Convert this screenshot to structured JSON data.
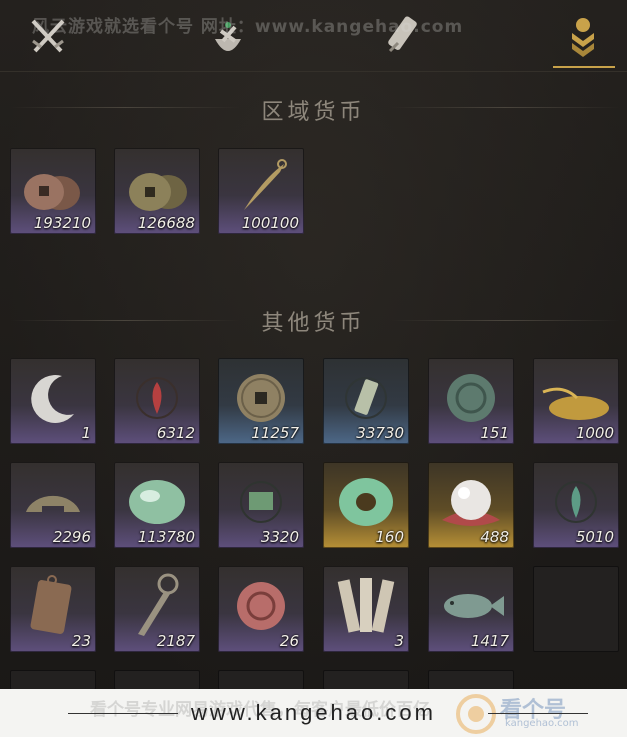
{
  "watermark_top": "风云游戏就选看个号  网址：www.kangehao.com",
  "tabs": [
    {
      "name": "crossed-swords-icon"
    },
    {
      "name": "pouch-icon"
    },
    {
      "name": "scroll-icon"
    },
    {
      "name": "currency-chevron-icon",
      "active": true
    }
  ],
  "colors": {
    "accent": "#c8a24a",
    "purple_tile": "#5e4f7c",
    "blue_tile": "#4d6888",
    "gold_tile": "#b79036"
  },
  "sections": {
    "regional": {
      "title": "区域货币"
    },
    "other": {
      "title": "其他货币"
    }
  },
  "regional_items": [
    {
      "icon": "copper-coin-stack-icon",
      "count": "193210"
    },
    {
      "icon": "bronze-coin-stack-icon",
      "count": "126688"
    },
    {
      "icon": "feather-token-icon",
      "count": "100100"
    }
  ],
  "other_items": [
    {
      "icon": "crescent-moon-icon",
      "count": "1"
    },
    {
      "icon": "red-flame-emblem-icon",
      "count": "6312"
    },
    {
      "icon": "bronze-coin-icon",
      "count": "11257",
      "tier": "blue"
    },
    {
      "icon": "jade-tag-icon",
      "count": "33730",
      "tier": "blue"
    },
    {
      "icon": "jade-medallion-icon",
      "count": "151"
    },
    {
      "icon": "grain-pile-icon",
      "count": "1000"
    },
    {
      "icon": "broken-coin-icon",
      "count": "2296"
    },
    {
      "icon": "jade-stone-icon",
      "count": "113780"
    },
    {
      "icon": "map-fragment-icon",
      "count": "3320"
    },
    {
      "icon": "jade-ring-icon",
      "count": "160",
      "tier": "gold"
    },
    {
      "icon": "pearl-icon",
      "count": "488",
      "tier": "gold"
    },
    {
      "icon": "green-flame-emblem-icon",
      "count": "5010"
    },
    {
      "icon": "bronze-plaque-icon",
      "count": "23"
    },
    {
      "icon": "coin-sword-icon",
      "count": "2187"
    },
    {
      "icon": "red-medallion-icon",
      "count": "26"
    },
    {
      "icon": "bamboo-slips-icon",
      "count": "3"
    },
    {
      "icon": "jade-fish-icon",
      "count": "1417"
    },
    {
      "icon": "empty-slot",
      "count": ""
    }
  ],
  "bottom_bar": {
    "url": "www.kangehao.com",
    "ghost_text": "看个号专业网易游戏代售，每客户最低价百亿",
    "brand_name": "看个号",
    "brand_sub": "kangehao.com"
  }
}
